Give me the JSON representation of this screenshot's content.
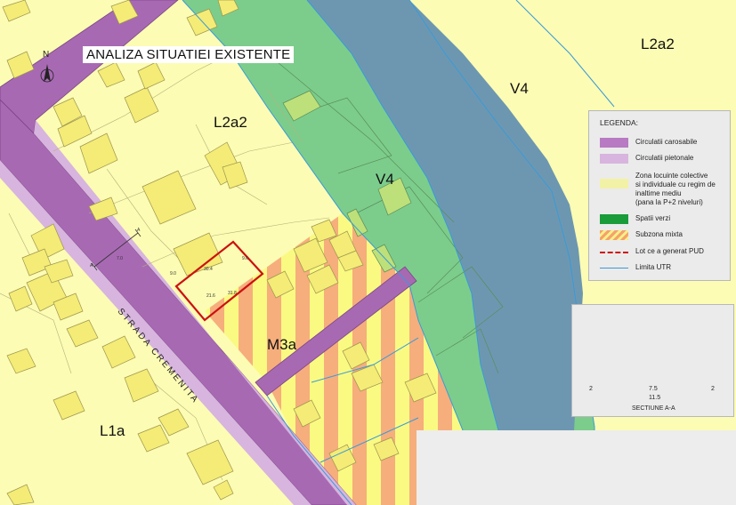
{
  "title": "ANALIZA SITUATIEI EXISTENTE",
  "north_label": "N",
  "street_name": "STRADA CREMENITA",
  "zone_labels": {
    "l2a2_top": "L2a2",
    "l2a2_center": "L2a2",
    "v4_river": "V4",
    "v4_center": "V4",
    "m3a": "M3a",
    "l1a": "L1a"
  },
  "legend": {
    "title": "LEGENDA:",
    "items": [
      {
        "label": "Circulatii carosabile",
        "color": "#b87ac2",
        "icon": "solid-swatch"
      },
      {
        "label": "Circulatii pietonale",
        "color": "#d7b5de",
        "icon": "solid-swatch"
      },
      {
        "label": "Zona locuinte colective\nsi individuale cu regim de\ninaltime mediu\n(pana la P+2 niveluri)",
        "color": "#f2f2a6",
        "icon": "solid-swatch"
      },
      {
        "label": "Spatii verzi",
        "color": "#1a9c3a",
        "icon": "solid-swatch"
      },
      {
        "label": "Subzona mixta",
        "color": "#f5c873",
        "icon": "hatched-swatch"
      },
      {
        "label": "Lot ce a generat PUD",
        "color": "#cc1111",
        "icon": "dashed-line"
      },
      {
        "label": "Limita UTR",
        "color": "#3a9ad8",
        "icon": "solid-line"
      }
    ]
  },
  "section": {
    "title": "SECTIUNE A-A",
    "dims": [
      "2",
      "7.5",
      "2"
    ],
    "total": "11.5"
  },
  "parcel_labels": {
    "a_left": "A",
    "a_right": "A",
    "width_note": "7.0",
    "lot_top": "30.4",
    "lot_bottom": "31.8",
    "lot_area": "21.6",
    "lot_left": "9.0",
    "lot_right": "9.6"
  },
  "colors": {
    "residential": "#fcfcb4",
    "building": "#f4ec76",
    "road": "#a869b3",
    "green": "#7ccd8c",
    "river": "#6d97b1",
    "mixed_stripe_a": "#f6ae7c",
    "mixed_stripe_b": "#fafa82",
    "lot_outline": "#cc1111",
    "utr_line": "#3a9ad8"
  }
}
